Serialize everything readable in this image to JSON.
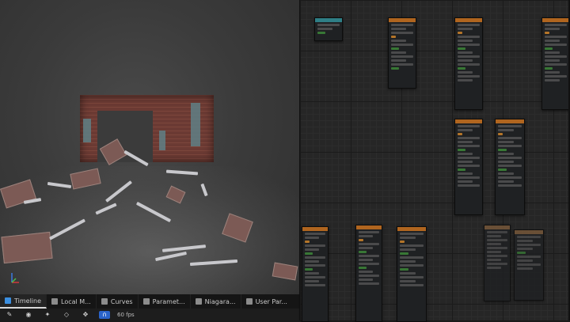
{
  "viewport": {
    "fps_label": "60 fps"
  },
  "bottom_tabs": [
    {
      "label": "Timeline",
      "active": true,
      "icon": "film-icon",
      "color": "#3b8fe0"
    },
    {
      "label": "Local M...",
      "active": false,
      "icon": "book-icon",
      "color": "#8c8c8c"
    },
    {
      "label": "Curves",
      "active": false,
      "icon": "curve-icon",
      "color": "#8c8c8c"
    },
    {
      "label": "Paramet...",
      "active": false,
      "icon": "list-icon",
      "color": "#8c8c8c"
    },
    {
      "label": "Niagara...",
      "active": false,
      "icon": "grid-icon",
      "color": "#8c8c8c"
    },
    {
      "label": "User Par...",
      "active": false,
      "icon": "user-icon",
      "color": "#8c8c8c"
    }
  ],
  "toolbar": {
    "items": [
      "wrench-icon",
      "eye-icon",
      "camera-icon",
      "diamond-icon",
      "snap-icon",
      "magnet-icon"
    ],
    "fps": "60 fps"
  },
  "colors": {
    "accent_blue": "#2a63c9",
    "node_header_orange": "#b0651f",
    "node_header_teal": "#2f7f86"
  }
}
